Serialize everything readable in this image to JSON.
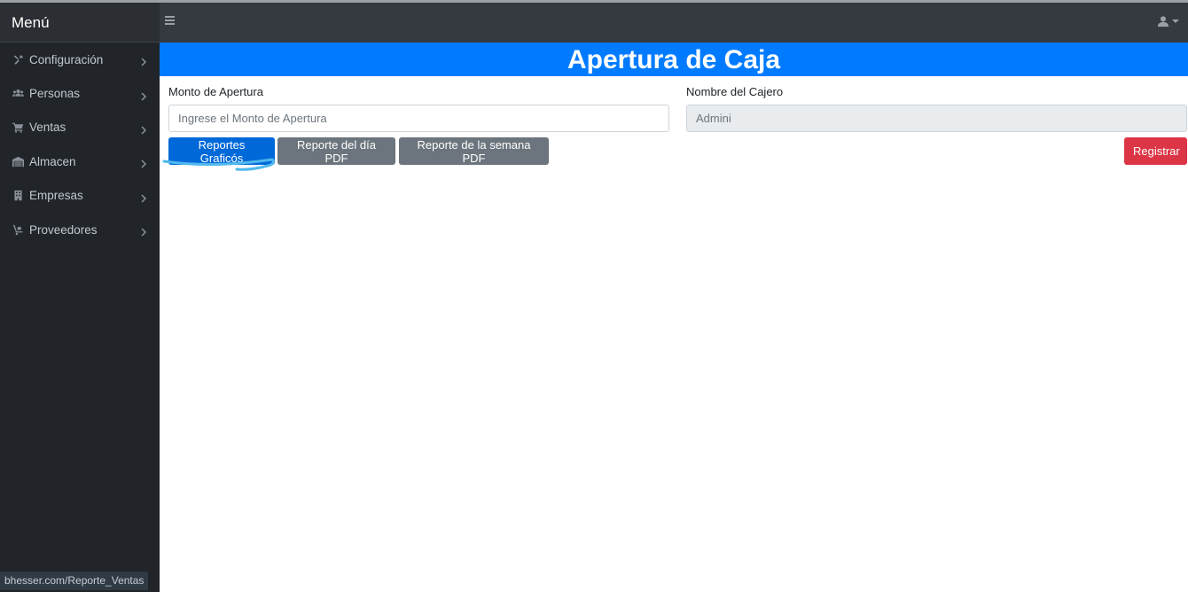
{
  "sidebar": {
    "brand": "Menú",
    "items": [
      {
        "label": "Configuración",
        "icon": "tools-icon"
      },
      {
        "label": "Personas",
        "icon": "users-icon"
      },
      {
        "label": "Ventas",
        "icon": "cart-icon"
      },
      {
        "label": "Almacen",
        "icon": "warehouse-icon"
      },
      {
        "label": "Empresas",
        "icon": "building-icon"
      },
      {
        "label": "Proveedores",
        "icon": "dolly-icon"
      }
    ]
  },
  "main": {
    "title": "Apertura de Caja",
    "monto": {
      "label": "Monto de Apertura",
      "placeholder": "Ingrese el Monto de Apertura",
      "value": ""
    },
    "cajero": {
      "label": "Nombre del Cajero",
      "value": "Admini"
    },
    "buttons": {
      "reportes_graficos": "Reportes Graficós",
      "reporte_dia": "Reporte del día PDF",
      "reporte_semana": "Reporte de la semana PDF",
      "registrar": "Registrar"
    }
  },
  "status_bar": {
    "url": "bhesser.com/Reporte_Ventas"
  },
  "colors": {
    "primary": "#007bff",
    "secondary": "#6c757d",
    "danger": "#dc3545",
    "sidebar": "#212529",
    "topbar": "#343a40"
  }
}
